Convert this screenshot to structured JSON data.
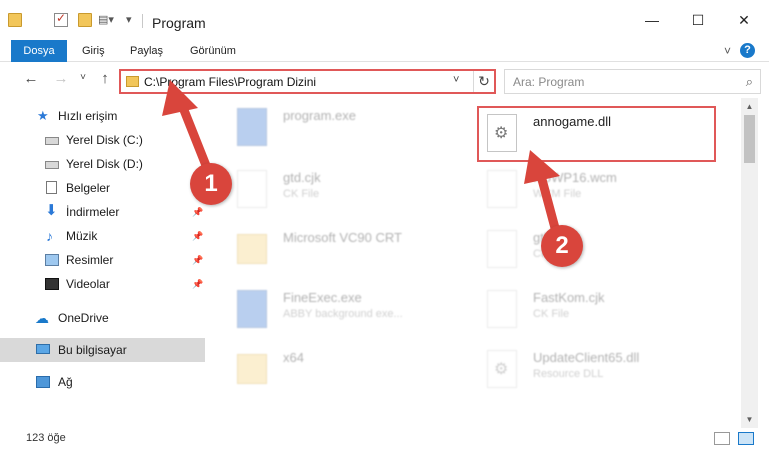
{
  "window": {
    "title": "Program",
    "minimize": "—",
    "maximize": "☐",
    "close": "✕"
  },
  "ribbon": {
    "tabs": [
      "Dosya",
      "Giriş",
      "Paylaş",
      "Görünüm"
    ],
    "expand_icon": "˅",
    "help_icon": "?"
  },
  "address": {
    "path": "C:\\Program Files\\Program Dizini",
    "chevron": "˅",
    "refresh": "↻"
  },
  "search": {
    "placeholder": "Ara: Program",
    "icon": "⌕"
  },
  "nav": {
    "back": "←",
    "forward": "→",
    "recent": "˅",
    "up": "↑"
  },
  "sidebar": {
    "items": [
      {
        "label": "Hızlı erişim",
        "icon": "star-icon"
      },
      {
        "label": "Yerel Disk (C:)",
        "icon": "drive-icon"
      },
      {
        "label": "Yerel Disk (D:)",
        "icon": "drive-icon"
      },
      {
        "label": "Belgeler",
        "icon": "document-icon"
      },
      {
        "label": "İndirmeler",
        "icon": "download-icon"
      },
      {
        "label": "Müzik",
        "icon": "music-icon"
      },
      {
        "label": "Resimler",
        "icon": "pictures-icon"
      },
      {
        "label": "Videolar",
        "icon": "video-icon"
      },
      {
        "label": "OneDrive",
        "icon": "cloud-icon"
      },
      {
        "label": "Bu bilgisayar",
        "icon": "computer-icon"
      },
      {
        "label": "Ağ",
        "icon": "network-icon"
      }
    ],
    "pin_glyph": "📌"
  },
  "files": {
    "items": [
      {
        "name": "program.exe",
        "type": ""
      },
      {
        "name": "annogame.dll",
        "type": ""
      },
      {
        "name": "gtd.cjk",
        "type": "CK File"
      },
      {
        "name": "...oWP16.wcm",
        "type": "WCM File"
      },
      {
        "name": "Microsoft VC90 CRT",
        "type": ""
      },
      {
        "name": "gtl",
        "type": "CI"
      },
      {
        "name": "FineExec.exe",
        "type": "ABBY background exe..."
      },
      {
        "name": "FastKom.cjk",
        "type": "CK File"
      },
      {
        "name": "x64",
        "type": ""
      },
      {
        "name": "UpdateClient65.dll",
        "type": "Resource DLL"
      }
    ]
  },
  "status": {
    "count": "123 öğe"
  },
  "annotations": {
    "step1": "1",
    "step2": "2",
    "color": "#d9453c"
  }
}
